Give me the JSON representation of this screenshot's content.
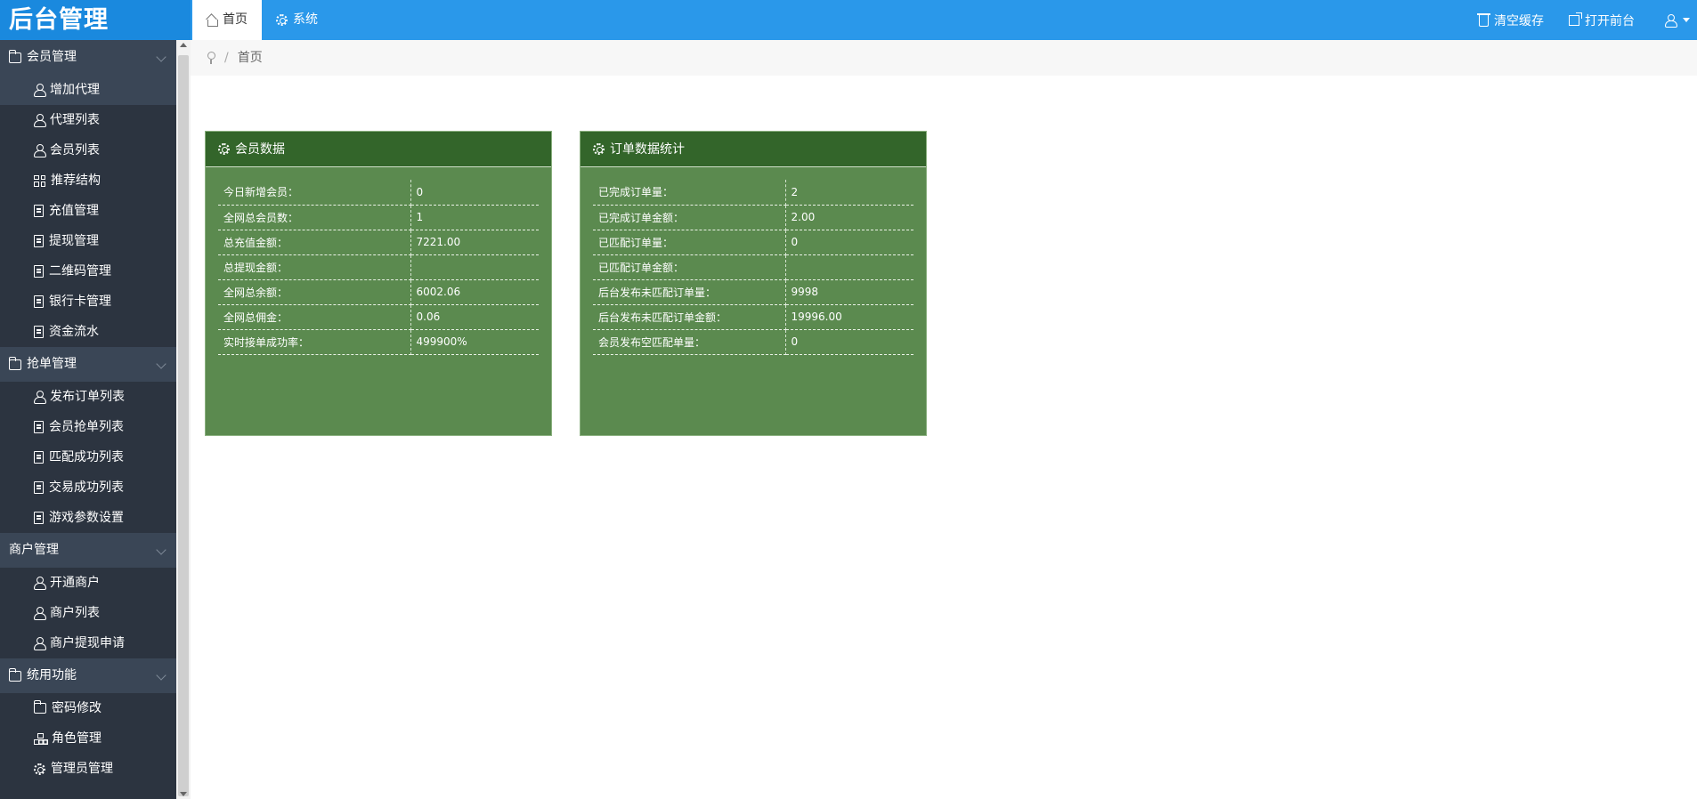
{
  "header": {
    "logo": "后台管理",
    "tabs": [
      {
        "label": "首页",
        "icon": "home-icon"
      },
      {
        "label": "系统",
        "icon": "gear-icon"
      }
    ],
    "right": [
      {
        "label": "清空缓存",
        "icon": "trash-icon"
      },
      {
        "label": "打开前台",
        "icon": "external-link-icon"
      }
    ]
  },
  "sidebar": {
    "groups": [
      {
        "title": "会员管理",
        "items": [
          {
            "label": "增加代理",
            "icon": "user-icon"
          },
          {
            "label": "代理列表",
            "icon": "user-icon"
          },
          {
            "label": "会员列表",
            "icon": "user-icon"
          },
          {
            "label": "推荐结构",
            "icon": "grid-icon"
          },
          {
            "label": "充值管理",
            "icon": "file-icon"
          },
          {
            "label": "提现管理",
            "icon": "file-icon"
          },
          {
            "label": "二维码管理",
            "icon": "file-icon"
          },
          {
            "label": "银行卡管理",
            "icon": "file-icon"
          },
          {
            "label": "资金流水",
            "icon": "file-icon"
          }
        ]
      },
      {
        "title": "抢单管理",
        "items": [
          {
            "label": "发布订单列表",
            "icon": "user-icon"
          },
          {
            "label": "会员抢单列表",
            "icon": "file-icon"
          },
          {
            "label": "匹配成功列表",
            "icon": "file-icon"
          },
          {
            "label": "交易成功列表",
            "icon": "file-icon"
          },
          {
            "label": "游戏参数设置",
            "icon": "file-icon"
          }
        ]
      },
      {
        "title": "商户管理",
        "items": [
          {
            "label": "开通商户",
            "icon": "user-icon"
          },
          {
            "label": "商户列表",
            "icon": "user-icon"
          },
          {
            "label": "商户提现申请",
            "icon": "user-icon"
          }
        ]
      },
      {
        "title": "统用功能",
        "items": [
          {
            "label": "密码修改",
            "icon": "folder-icon"
          },
          {
            "label": "角色管理",
            "icon": "sitemap-icon"
          },
          {
            "label": "管理员管理",
            "icon": "gear-icon"
          }
        ]
      }
    ]
  },
  "breadcrumb": {
    "current": "首页",
    "separator": "/"
  },
  "panels": {
    "members": {
      "title": "会员数据",
      "rows": [
        {
          "key": "今日新增会员：",
          "value": "0"
        },
        {
          "key": "全网总会员数：",
          "value": "1"
        },
        {
          "key": "总充值金额：",
          "value": "7221.00"
        },
        {
          "key": "总提现金额：",
          "value": ""
        },
        {
          "key": "全网总余额：",
          "value": "6002.06"
        },
        {
          "key": "全网总佣金：",
          "value": "0.06"
        },
        {
          "key": "实时接单成功率：",
          "value": "499900%"
        }
      ]
    },
    "orders": {
      "title": "订单数据统计",
      "rows": [
        {
          "key": "已完成订单量：",
          "value": "2"
        },
        {
          "key": "已完成订单金额：",
          "value": "2.00"
        },
        {
          "key": "已匹配订单量：",
          "value": "0"
        },
        {
          "key": "已匹配订单金额：",
          "value": ""
        },
        {
          "key": "后台发布未匹配订单量：",
          "value": "9998"
        },
        {
          "key": "后台发布未匹配订单金额：",
          "value": "19996.00"
        },
        {
          "key": "会员发布空匹配单量：",
          "value": "0"
        }
      ]
    }
  },
  "colors": {
    "header": "#2a98ea",
    "logo_bg": "#1a89de",
    "sidebar": "#2c3440",
    "sidebar_group": "#3a4656",
    "panel": "#5b8a4f",
    "panel_head": "#33652a"
  }
}
